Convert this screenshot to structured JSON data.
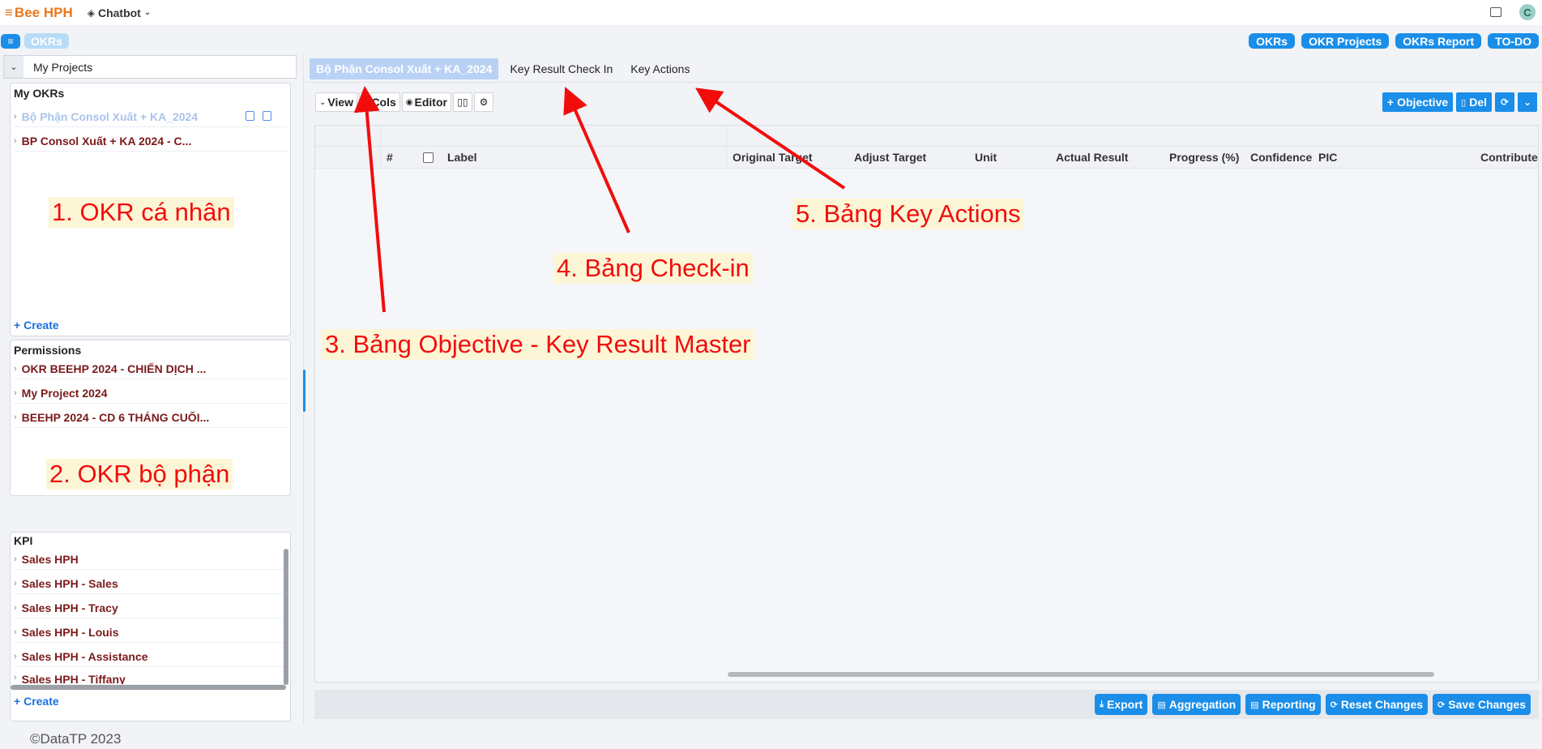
{
  "topbar": {
    "brand": "Bee HPH",
    "chatbot": "Chatbot"
  },
  "navbar": {
    "chip": "OKRs",
    "links": [
      "OKRs",
      "OKR Projects",
      "OKRs Report",
      "TO-DO"
    ]
  },
  "sidebar": {
    "project_header": "My Projects",
    "my_okrs": {
      "title": "My OKRs",
      "items": [
        "Bộ Phận Consol Xuất + KA_2024",
        "BP Consol Xuất + KA 2024 - C..."
      ],
      "create": "Create"
    },
    "permissions": {
      "title": "Permissions",
      "items": [
        "OKR BEEHP 2024 - CHIẾN DỊCH ...",
        "My Project 2024",
        "BEEHP 2024 - CD 6 THÁNG CUỐI..."
      ]
    },
    "kpi": {
      "title": "KPI",
      "items": [
        "Sales HPH",
        "Sales HPH - Sales",
        "Sales HPH - Tracy",
        "Sales HPH - Louis",
        "Sales HPH - Assistance",
        "Sales HPH - Tiffany"
      ],
      "create": "Create"
    }
  },
  "tabs": [
    "Bộ Phận Consol Xuất + KA_2024",
    "Key Result Check In",
    "Key Actions"
  ],
  "toolbar": {
    "view": "View",
    "cols": "Cols",
    "editor": "Editor",
    "objective": "Objective",
    "del": "Del"
  },
  "table": {
    "columns": [
      "#",
      "Label",
      "Original Target",
      "Adjust Target",
      "Unit",
      "Actual Result",
      "Progress (%)",
      "Confidence",
      "PIC",
      "Contribute"
    ]
  },
  "footer_buttons": [
    "Export",
    "Aggregation",
    "Reporting",
    "Reset Changes",
    "Save Changes"
  ],
  "copyright": "©DataTP 2023",
  "annotations": {
    "a1": "1. OKR cá nhân",
    "a2": "2. OKR bộ phận",
    "a3": "3. Bảng Objective - Key Result Master",
    "a4": "4. Bảng Check-in",
    "a5": "5. Bảng Key Actions"
  },
  "colors": {
    "primary": "#1a8ee8",
    "brand": "#e9791f",
    "annotation": "#f20d0d",
    "item": "#7b1a1a"
  }
}
